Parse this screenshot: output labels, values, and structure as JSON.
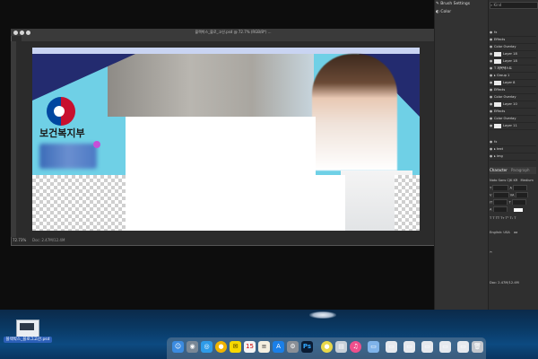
{
  "photoshop": {
    "window_title": "블랙박스_블로_고산.psd @ 72.7% (RGB/8*) ...",
    "status_zoom": "72.73%",
    "status_doc": "Doc: 2.47M/12.4M"
  },
  "document": {
    "logo_text": "보건복지부"
  },
  "panels": {
    "brush_settings": "Brush Settings",
    "color": "Color",
    "search_kind": "Kind",
    "character_tab": "Character",
    "paragraph_tab": "Paragraph",
    "font_family": "Noto Sans CJK KR",
    "font_style": "Medium",
    "language": "English: USA",
    "doc_size": "Doc: 2.47M/12.4M"
  },
  "layers": [
    {
      "name": "fx"
    },
    {
      "name": "Effects"
    },
    {
      "name": "Color Overlay"
    },
    {
      "name": "Layer 18"
    },
    {
      "name": "Layer 18"
    },
    {
      "name": "제목텍스트"
    },
    {
      "name": "Group 1"
    },
    {
      "name": "Layer 8"
    },
    {
      "name": "Effects"
    },
    {
      "name": "Color Overlay"
    },
    {
      "name": "Layer 10"
    },
    {
      "name": "Effects"
    },
    {
      "name": "Color Overlay"
    },
    {
      "name": "Layer 11"
    },
    {
      "name": "fx"
    },
    {
      "name": "text"
    },
    {
      "name": "img"
    }
  ],
  "desktop": {
    "file_label": "블랙박스_블로그고산.psd"
  },
  "dock": {
    "apps": [
      "Finder",
      "Launchpad",
      "Safari",
      "Chrome",
      "KakaoTalk",
      "Calendar",
      "Notes",
      "App Store",
      "System Preferences",
      "Photoshop",
      "Preview",
      "iTunes",
      "Trash"
    ]
  }
}
